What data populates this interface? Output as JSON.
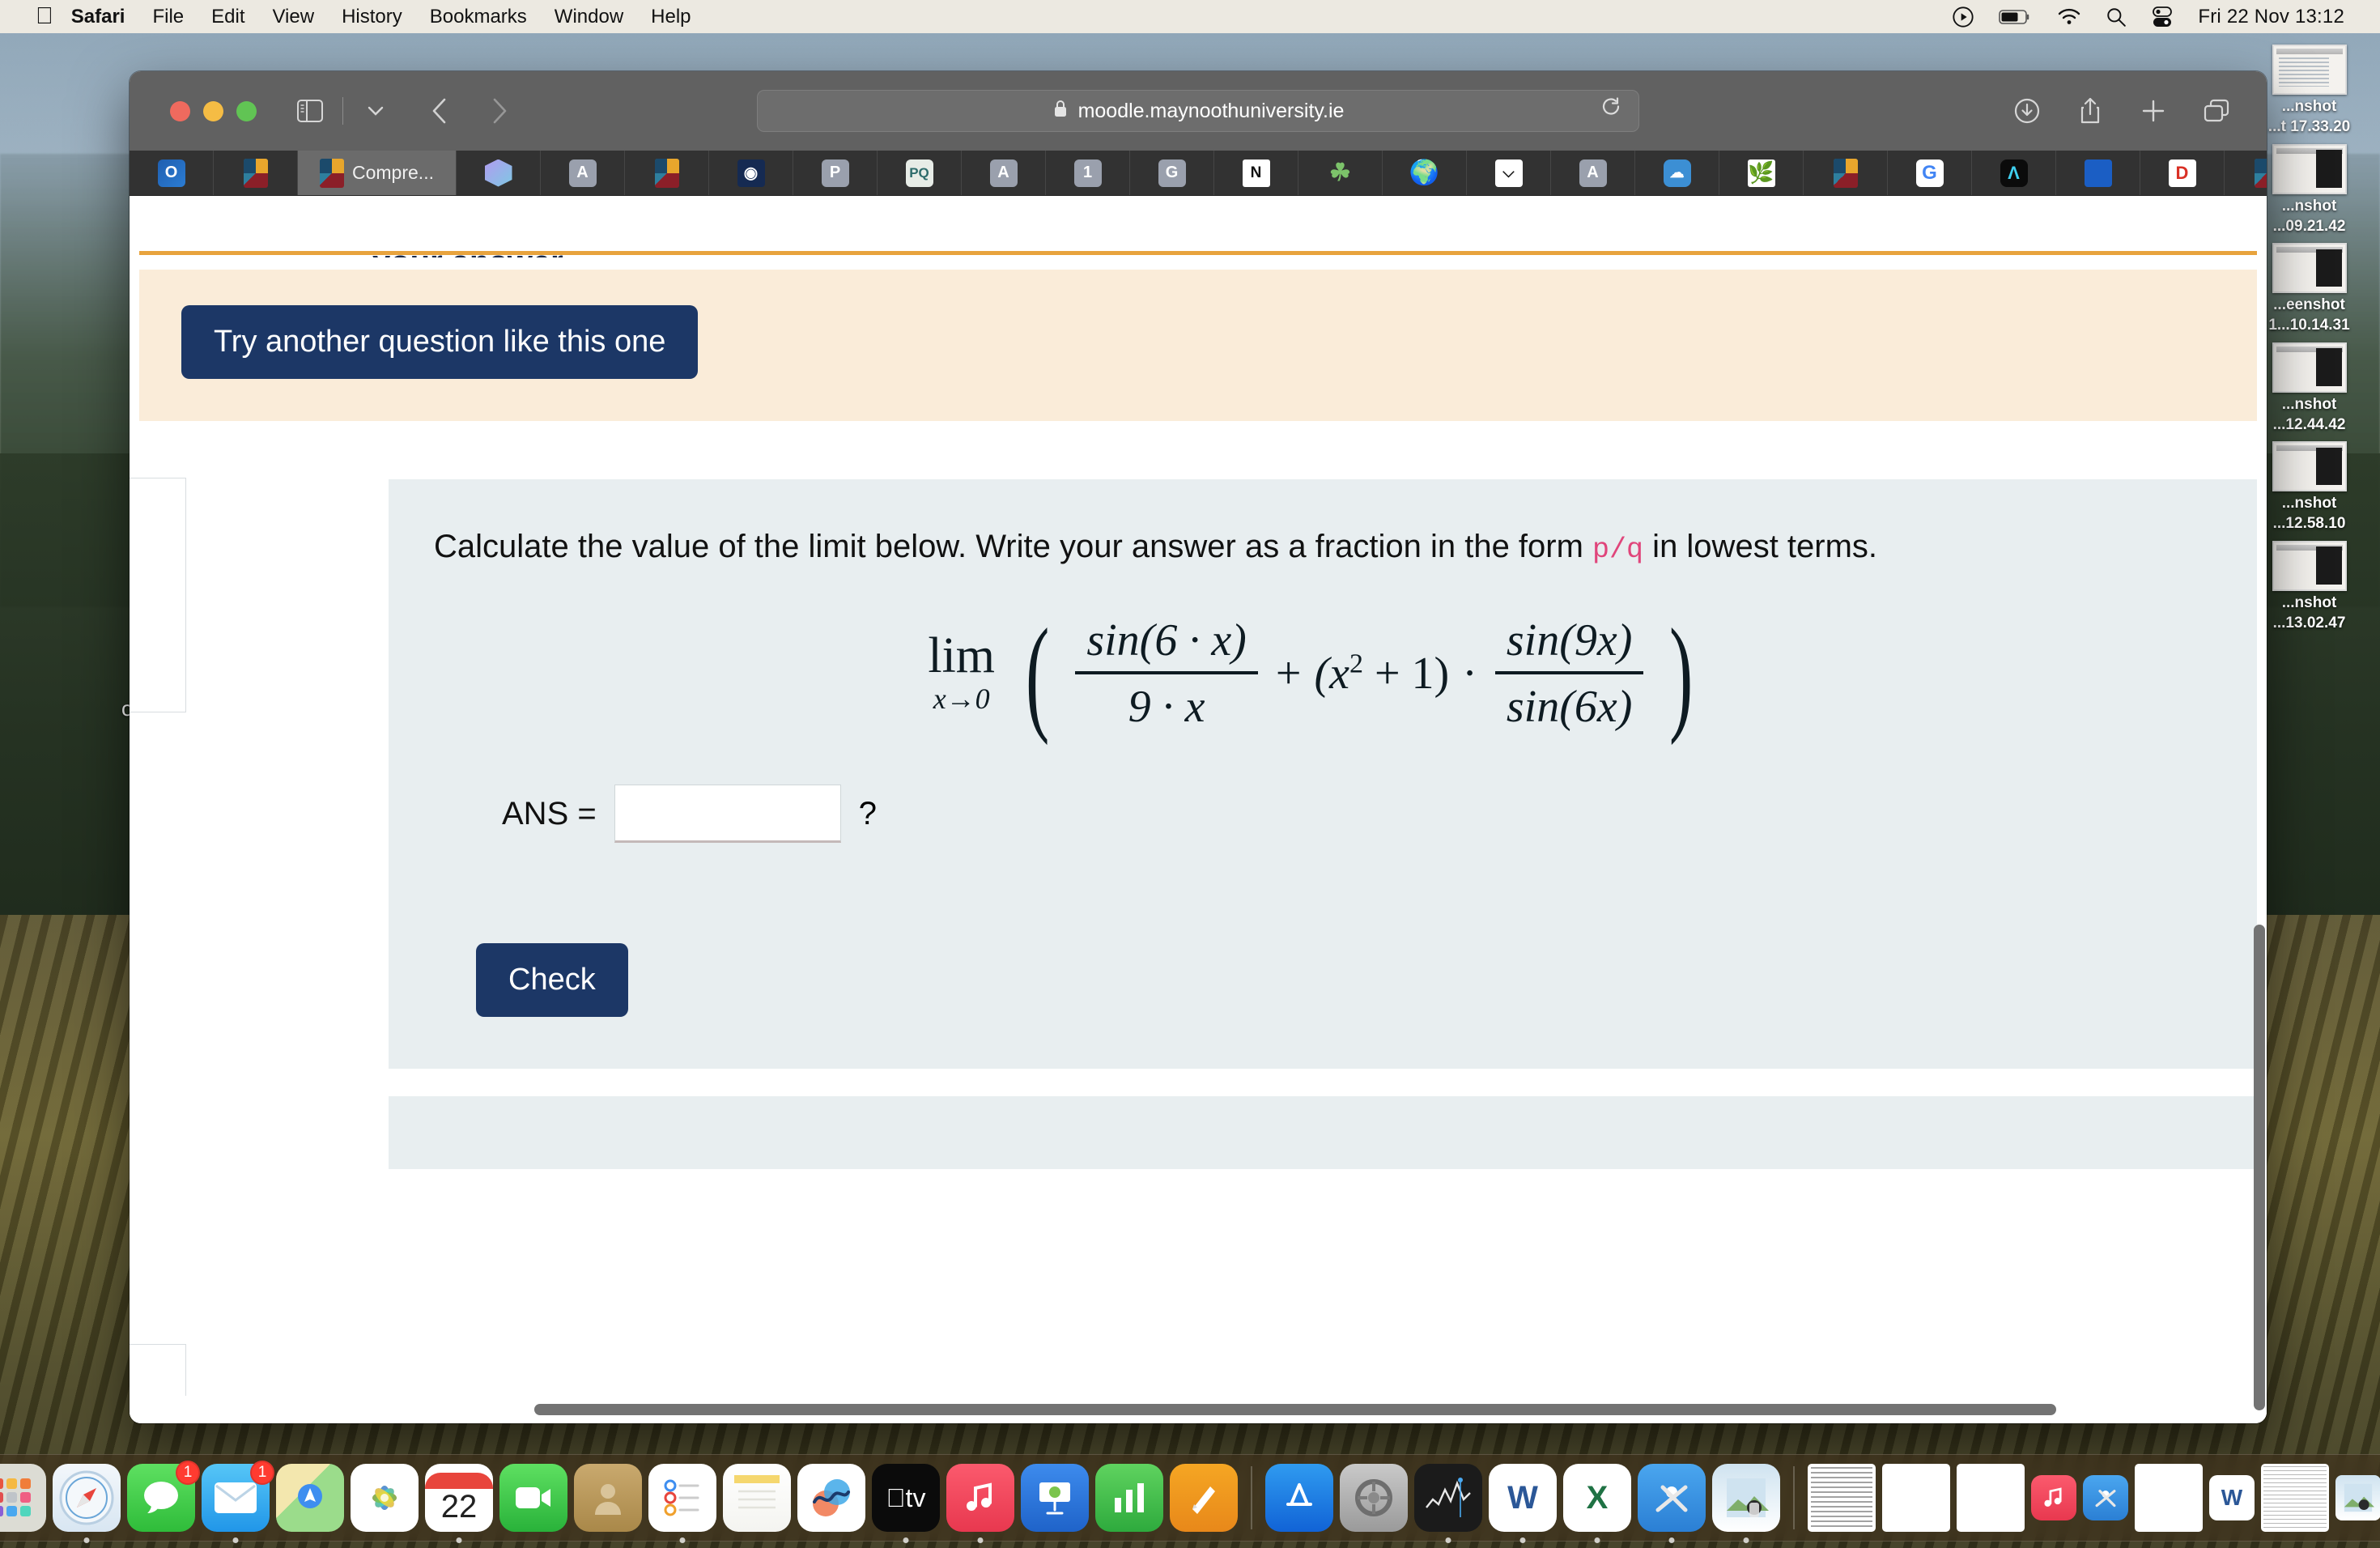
{
  "menubar": {
    "apple_icon": "apple-logo",
    "items": [
      {
        "label": "Safari",
        "bold": true
      },
      {
        "label": "File",
        "bold": false
      },
      {
        "label": "Edit",
        "bold": false
      },
      {
        "label": "View",
        "bold": false
      },
      {
        "label": "History",
        "bold": false
      },
      {
        "label": "Bookmarks",
        "bold": false
      },
      {
        "label": "Window",
        "bold": false
      },
      {
        "label": "Help",
        "bold": false
      }
    ],
    "status_icons": [
      "play-circle-icon",
      "battery-icon",
      "wifi-icon",
      "search-icon",
      "control-center-icon"
    ],
    "clock": "Fri 22 Nov 13:12"
  },
  "browser": {
    "traffic_lights": [
      "close-button",
      "minimize-button",
      "zoom-button"
    ],
    "toolbar_icons": [
      "sidebar-toggle-icon",
      "chevron-down-icon",
      "back-arrow-icon",
      "forward-arrow-icon"
    ],
    "address": {
      "lock_icon": "lock-icon",
      "url": "moodle.maynoothuniversity.ie",
      "reload_icon": "reload-icon"
    },
    "right_icons": [
      "downloads-icon",
      "share-icon",
      "new-tab-icon",
      "tab-overview-icon"
    ],
    "tabs": [
      {
        "favicon": "outlook-icon",
        "label": "",
        "active": false
      },
      {
        "favicon": "maynooth-shield-icon",
        "label": "",
        "active": false
      },
      {
        "favicon": "maynooth-shield-icon",
        "label": "Compre...",
        "active": true
      },
      {
        "favicon": "purple-gem-icon",
        "label": "",
        "active": false
      },
      {
        "favicon": "letter-a-icon",
        "label": "",
        "active": false
      },
      {
        "favicon": "maynooth-shield-icon",
        "label": "",
        "active": false
      },
      {
        "favicon": "circle-emblem-icon",
        "label": "",
        "active": false
      },
      {
        "favicon": "letter-p-icon",
        "label": "",
        "active": false
      },
      {
        "favicon": "pq-icon",
        "label": "",
        "active": false
      },
      {
        "favicon": "letter-a-icon",
        "label": "",
        "active": false
      },
      {
        "favicon": "number-one-icon",
        "label": "",
        "active": false
      },
      {
        "favicon": "letter-g-icon",
        "label": "",
        "active": false
      },
      {
        "favicon": "notion-icon",
        "label": "",
        "active": false
      },
      {
        "favicon": "clover-icon",
        "label": "",
        "active": false
      },
      {
        "favicon": "globe-icon",
        "label": "",
        "active": false
      },
      {
        "favicon": "vee-icon",
        "label": "",
        "active": false
      },
      {
        "favicon": "letter-a-icon",
        "label": "",
        "active": false
      },
      {
        "favicon": "cloud-doc-icon",
        "label": "",
        "active": false
      },
      {
        "favicon": "leaf-icon",
        "label": "",
        "active": false
      },
      {
        "favicon": "maynooth-shield-icon",
        "label": "",
        "active": false
      },
      {
        "favicon": "google-icon",
        "label": "",
        "active": false
      },
      {
        "favicon": "a-dark-icon",
        "label": "",
        "active": false
      },
      {
        "favicon": "blue-square-icon",
        "label": "",
        "active": false
      },
      {
        "favicon": "letter-d-icon",
        "label": "",
        "active": false
      },
      {
        "favicon": "maynooth-shield-icon",
        "label": "",
        "active": false
      },
      {
        "favicon": "google-icon",
        "label": "",
        "active": false
      }
    ]
  },
  "page": {
    "try_another_button": "Try another question like this one",
    "question_part1": "Calculate the value of the limit below.  Write your answer as a fraction in the form ",
    "question_code": "p/q",
    "question_part2": " in lowest terms.",
    "formula": {
      "lim_label": "lim",
      "lim_sub": "x→0",
      "open_paren": "(",
      "frac1_num": "sin(6 · x)",
      "frac1_den": "9 · x",
      "plus": "+",
      "factor": "(x",
      "factor_exp": "2",
      "factor_tail": " + 1)",
      "dot": "·",
      "frac2_num": "sin(9x)",
      "frac2_den": "sin(6x)",
      "close_paren": ")"
    },
    "answer_label": "ANS =",
    "answer_value": "",
    "answer_placeholder": "",
    "answer_suffix": "?",
    "check_button": "Check",
    "clipped_heading": "your answer."
  },
  "desktop": {
    "partial_text": "of",
    "files": [
      {
        "label_line1": "...nshot",
        "label_line2": "...t 17.33.20",
        "dark": true
      },
      {
        "label_line1": "...nshot",
        "label_line2": "...09.21.42",
        "dark": true
      },
      {
        "label_line1": "...eenshot",
        "label_line2": "1...10.14.31",
        "dark": true
      },
      {
        "label_line1": "...nshot",
        "label_line2": "...12.44.42",
        "dark": true
      },
      {
        "label_line1": "...nshot",
        "label_line2": "...12.58.10",
        "dark": true
      },
      {
        "label_line1": "...nshot",
        "label_line2": "...13.02.47",
        "dark": true
      }
    ]
  },
  "dock": {
    "items": [
      {
        "name": "finder",
        "class": "di-finder",
        "glyph": "",
        "running": true,
        "badge": ""
      },
      {
        "name": "launchpad",
        "class": "di-launchpad",
        "glyph": "",
        "running": false,
        "badge": ""
      },
      {
        "name": "safari",
        "class": "di-safari",
        "glyph": "◉",
        "running": true,
        "badge": ""
      },
      {
        "name": "messages",
        "class": "di-messages",
        "glyph": "💬",
        "running": false,
        "badge": "1"
      },
      {
        "name": "mail",
        "class": "di-mail",
        "glyph": "✉",
        "running": true,
        "badge": "1"
      },
      {
        "name": "maps",
        "class": "di-maps",
        "glyph": "",
        "running": false,
        "badge": ""
      },
      {
        "name": "photos",
        "class": "di-photos",
        "glyph": "",
        "running": false,
        "badge": ""
      },
      {
        "name": "calendar",
        "class": "di-calendar",
        "glyph": "22",
        "running": true,
        "badge": ""
      },
      {
        "name": "facetime",
        "class": "di-facetime",
        "glyph": "▶",
        "running": false,
        "badge": ""
      },
      {
        "name": "contacts",
        "class": "di-contacts",
        "glyph": "👤",
        "running": false,
        "badge": ""
      },
      {
        "name": "reminders",
        "class": "di-reminders",
        "glyph": "",
        "running": true,
        "badge": ""
      },
      {
        "name": "notes",
        "class": "di-notes",
        "glyph": "",
        "running": false,
        "badge": ""
      },
      {
        "name": "freeform",
        "class": "di-freeform",
        "glyph": "〜",
        "running": false,
        "badge": ""
      },
      {
        "name": "apple-tv",
        "class": "di-tv",
        "glyph": "tv",
        "running": true,
        "badge": ""
      },
      {
        "name": "music",
        "class": "di-music",
        "glyph": "♫",
        "running": true,
        "badge": ""
      },
      {
        "name": "keynote",
        "class": "di-keynote",
        "glyph": "",
        "running": false,
        "badge": ""
      },
      {
        "name": "numbers",
        "class": "di-numbers",
        "glyph": "",
        "running": false,
        "badge": ""
      },
      {
        "name": "pages",
        "class": "di-pages",
        "glyph": "✐",
        "running": false,
        "badge": ""
      },
      {
        "name": "app-store",
        "class": "di-appstore",
        "glyph": "A",
        "running": false,
        "badge": ""
      },
      {
        "name": "system-settings",
        "class": "di-settings",
        "glyph": "⚙",
        "running": false,
        "badge": ""
      },
      {
        "name": "stocks",
        "class": "di-stocks",
        "glyph": "",
        "running": true,
        "badge": ""
      },
      {
        "name": "microsoft-word",
        "class": "di-word",
        "glyph": "W",
        "running": true,
        "badge": ""
      },
      {
        "name": "microsoft-excel",
        "class": "di-excel",
        "glyph": "X",
        "running": true,
        "badge": ""
      },
      {
        "name": "wifi-utility",
        "class": "di-wifi",
        "glyph": "🛠",
        "running": true,
        "badge": ""
      },
      {
        "name": "preview",
        "class": "di-preview",
        "glyph": "",
        "running": true,
        "badge": ""
      }
    ],
    "minimized": [
      {
        "name": "document-window"
      },
      {
        "name": "dark-window"
      },
      {
        "name": "wifi-window"
      },
      {
        "name": "music-window"
      },
      {
        "name": "wifi-tool-window"
      },
      {
        "name": "black-window"
      },
      {
        "name": "word-window"
      },
      {
        "name": "notes-window"
      },
      {
        "name": "preview-window"
      }
    ],
    "trash": "trash-icon"
  }
}
